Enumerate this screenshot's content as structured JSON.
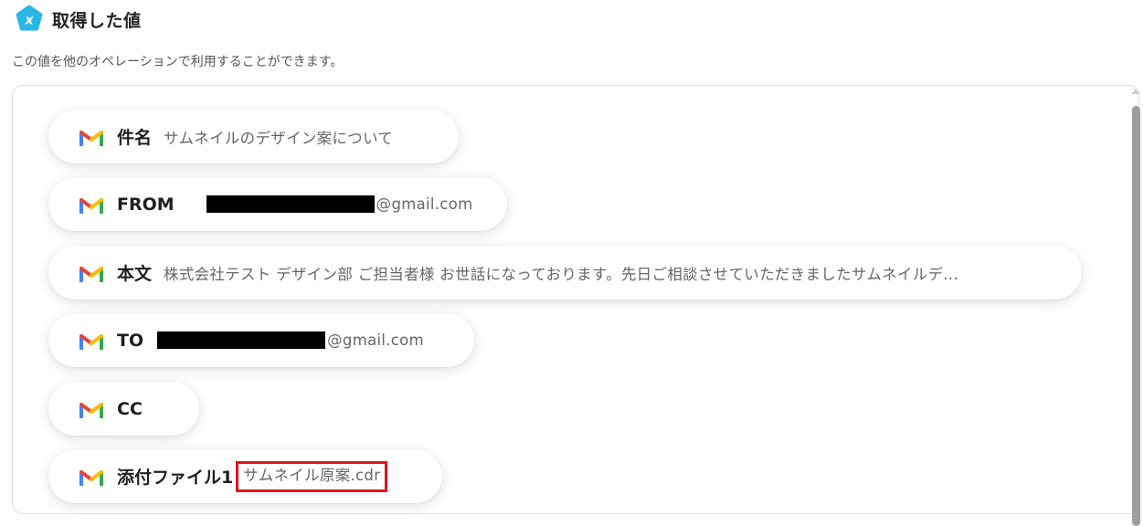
{
  "header": {
    "icon": "variable-x-icon",
    "title": "取得した値"
  },
  "description": "この値を他のオペレーションで利用することができます。",
  "items": [
    {
      "icon": "gmail-icon",
      "label": "件名",
      "value": "サムネイルのデザイン案について"
    },
    {
      "icon": "gmail-icon",
      "label": "FROM",
      "value": "@gmail.com",
      "redacted": true
    },
    {
      "icon": "gmail-icon",
      "label": "本文",
      "value": "株式会社テスト デザイン部 ご担当者様 お世話になっております。先日ご相談させていただきましたサムネイルデ..."
    },
    {
      "icon": "gmail-icon",
      "label": "TO",
      "value": "@gmail.com",
      "redacted": true
    },
    {
      "icon": "gmail-icon",
      "label": "CC",
      "value": ""
    },
    {
      "icon": "gmail-icon",
      "label": "添付ファイル1",
      "value": "サムネイル原案.cdr",
      "highlighted": true
    }
  ],
  "colors": {
    "accent": "#29b6e5",
    "highlight_border": "#e0141d"
  }
}
